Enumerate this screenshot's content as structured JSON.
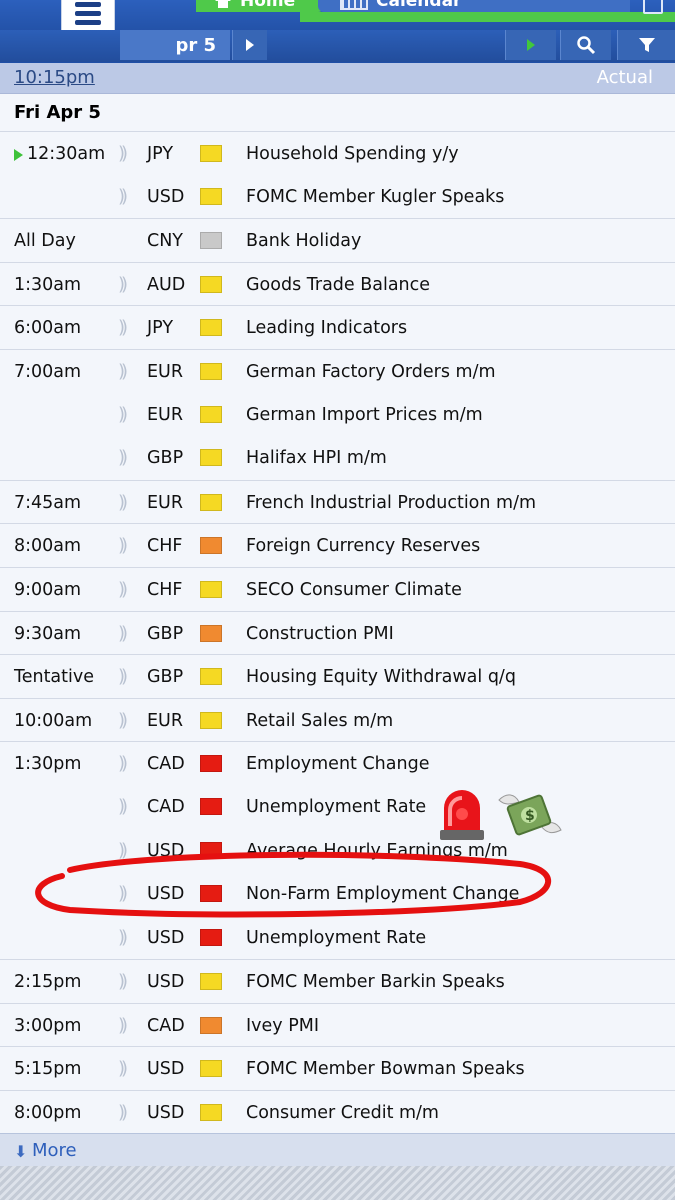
{
  "header": {
    "tabs": [
      {
        "label": "Home",
        "active": true
      },
      {
        "label": "Calendar",
        "active": false
      }
    ],
    "date_label": "pr 5"
  },
  "columns": {
    "time_label": "10:15pm",
    "actual_label": "Actual"
  },
  "day": "Fri Apr 5",
  "impact_colors": {
    "low": "#f5d923",
    "medium": "#f08a30",
    "high": "#e51c12",
    "holiday": "#c9c9c9"
  },
  "events": [
    {
      "time": "12:30am",
      "current": true,
      "currency": "JPY",
      "impact": "low",
      "event": "Household Spending y/y",
      "group_start": true
    },
    {
      "time": "",
      "currency": "USD",
      "impact": "low",
      "event": "FOMC Member Kugler Speaks"
    },
    {
      "time": "All Day",
      "currency": "CNY",
      "impact": "holiday",
      "event": "Bank Holiday",
      "group_start": true,
      "no_sound": true
    },
    {
      "time": "1:30am",
      "currency": "AUD",
      "impact": "low",
      "event": "Goods Trade Balance",
      "group_start": true
    },
    {
      "time": "6:00am",
      "currency": "JPY",
      "impact": "low",
      "event": "Leading Indicators",
      "group_start": true
    },
    {
      "time": "7:00am",
      "currency": "EUR",
      "impact": "low",
      "event": "German Factory Orders m/m",
      "group_start": true
    },
    {
      "time": "",
      "currency": "EUR",
      "impact": "low",
      "event": "German Import Prices m/m"
    },
    {
      "time": "",
      "currency": "GBP",
      "impact": "low",
      "event": "Halifax HPI m/m"
    },
    {
      "time": "7:45am",
      "currency": "EUR",
      "impact": "low",
      "event": "French Industrial Production m/m",
      "group_start": true
    },
    {
      "time": "8:00am",
      "currency": "CHF",
      "impact": "medium",
      "event": "Foreign Currency Reserves",
      "group_start": true
    },
    {
      "time": "9:00am",
      "currency": "CHF",
      "impact": "low",
      "event": "SECO Consumer Climate",
      "group_start": true
    },
    {
      "time": "9:30am",
      "currency": "GBP",
      "impact": "medium",
      "event": "Construction PMI",
      "group_start": true
    },
    {
      "time": "Tentative",
      "currency": "GBP",
      "impact": "low",
      "event": "Housing Equity Withdrawal q/q",
      "group_start": true
    },
    {
      "time": "10:00am",
      "currency": "EUR",
      "impact": "low",
      "event": "Retail Sales m/m",
      "group_start": true
    },
    {
      "time": "1:30pm",
      "currency": "CAD",
      "impact": "high",
      "event": "Employment Change",
      "group_start": true
    },
    {
      "time": "",
      "currency": "CAD",
      "impact": "high",
      "event": "Unemployment Rate"
    },
    {
      "time": "",
      "currency": "USD",
      "impact": "high",
      "event": "Average Hourly Earnings m/m"
    },
    {
      "time": "",
      "currency": "USD",
      "impact": "high",
      "event": "Non-Farm Employment Change"
    },
    {
      "time": "",
      "currency": "USD",
      "impact": "high",
      "event": "Unemployment Rate"
    },
    {
      "time": "2:15pm",
      "currency": "USD",
      "impact": "low",
      "event": "FOMC Member Barkin Speaks",
      "group_start": true
    },
    {
      "time": "3:00pm",
      "currency": "CAD",
      "impact": "medium",
      "event": "Ivey PMI",
      "group_start": true
    },
    {
      "time": "5:15pm",
      "currency": "USD",
      "impact": "low",
      "event": "FOMC Member Bowman Speaks",
      "group_start": true
    },
    {
      "time": "8:00pm",
      "currency": "USD",
      "impact": "low",
      "event": "Consumer Credit m/m",
      "group_start": true
    }
  ],
  "more_label": "More"
}
